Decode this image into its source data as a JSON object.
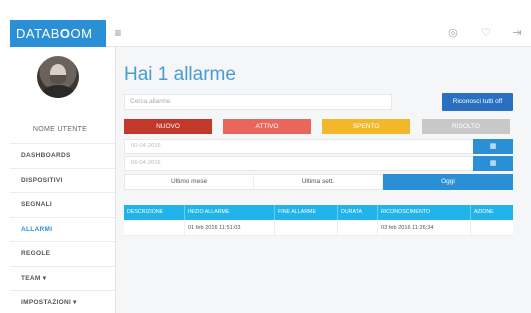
{
  "header": {
    "logo_part1": "DATAB",
    "logo_part2": "O",
    "logo_part3": "OM",
    "menu_icon": "hamburger-icon",
    "icons": [
      "globe-icon",
      "bell-icon",
      "logout-icon"
    ]
  },
  "sidebar": {
    "username": "NOME UTENTE",
    "items": [
      {
        "label": "DASHBOARDS"
      },
      {
        "label": "DISPOSITIVI"
      },
      {
        "label": "SEGNALI"
      },
      {
        "label": "ALLARMI"
      },
      {
        "label": "REGOLE"
      },
      {
        "label": "TEAM ▾"
      },
      {
        "label": "IMPOSTAZIONI ▾"
      }
    ],
    "active_index": 3
  },
  "main": {
    "title": "Hai 1 allarme",
    "search_placeholder": "Cerca allarme",
    "ack_all_label": "Riconosci tutti off",
    "filters": [
      {
        "label": "NUOVO",
        "color": "#c0392b"
      },
      {
        "label": "ATTIVO",
        "color": "#e8675c"
      },
      {
        "label": "SPENTO",
        "color": "#f3b82a"
      },
      {
        "label": "RISOLTO",
        "color": "#c8c8c8"
      }
    ],
    "date_from": "00-04-2016",
    "date_to": "06-04-2016",
    "calendar_icon": "calendar-icon",
    "periods": [
      "Ultimo mese",
      "Ultima sett.",
      "Oggi"
    ],
    "active_period": 2,
    "table": {
      "headers": [
        "DESCRIZIONE",
        "INIZIO ALLARME",
        "FINE ALLARME",
        "DURATA",
        "RICONOSCIMENTO",
        "AZIONE"
      ],
      "rows": [
        [
          "",
          "01 feb 2016 11:51:03",
          "",
          "",
          "03 feb 2016 11:26:34",
          ""
        ]
      ]
    }
  }
}
